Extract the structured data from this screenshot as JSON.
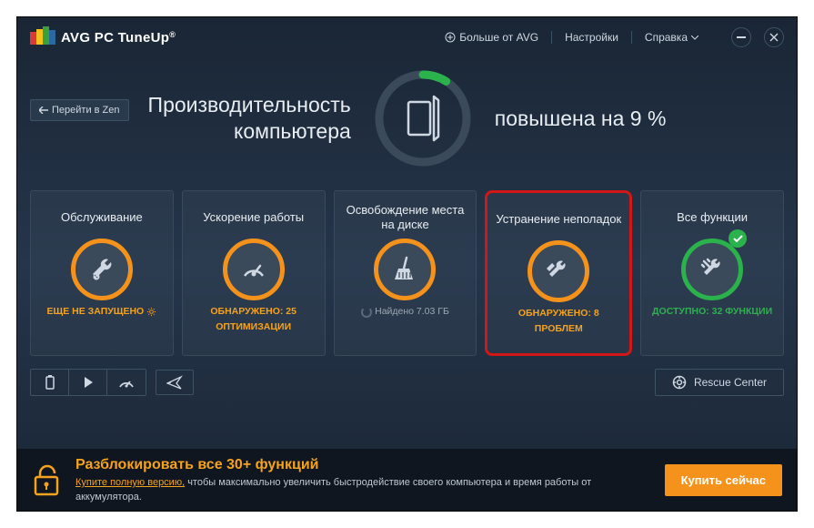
{
  "app": {
    "name_prefix": "AVG",
    "name": "PC TuneUp",
    "reg": "®"
  },
  "topmenu": {
    "more": "Больше от AVG",
    "settings": "Настройки",
    "help": "Справка"
  },
  "zen_label": "Перейти в Zen",
  "hero": {
    "left_line1": "Производительность",
    "left_line2": "компьютера",
    "right": "повышена на 9 %"
  },
  "cards": [
    {
      "title": "Обслуживание",
      "status": "ЕЩЕ НЕ ЗАПУЩЕНО"
    },
    {
      "title": "Ускорение работы",
      "status1": "ОБНАРУЖЕНО: 25",
      "status2": "ОПТИМИЗАЦИИ"
    },
    {
      "title": "Освобождение места на диске",
      "status": "Найдено 7.03 ГБ"
    },
    {
      "title": "Устранение неполадок",
      "status1": "ОБНАРУЖЕНО: 8",
      "status2": "ПРОБЛЕМ"
    },
    {
      "title": "Все функции",
      "status": "ДОСТУПНО: 32 ФУНКЦИИ"
    }
  ],
  "rescue": "Rescue Center",
  "banner": {
    "title": "Разблокировать все 30+ функций",
    "link": "Купите полную версию,",
    "rest": "чтобы максимально увеличить быстродействие своего компьютера и время работы от аккумулятора.",
    "buy": "Купить сейчас"
  }
}
